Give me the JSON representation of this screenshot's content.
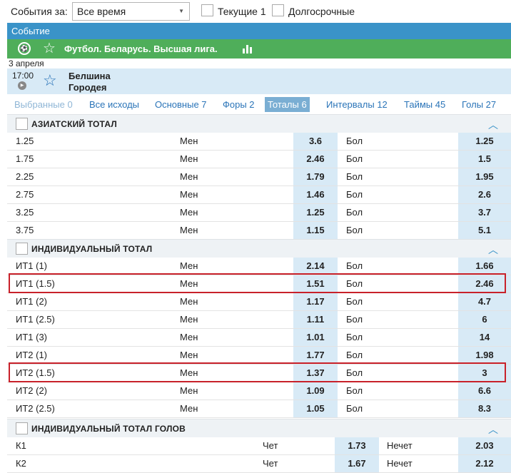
{
  "filter": {
    "label": "События за:",
    "period": "Все время",
    "current_label": "Текущие 1",
    "longterm_label": "Долгосрочные"
  },
  "event_header": "Событие",
  "league": {
    "title": "Футбол. Беларусь. Высшая лига."
  },
  "match": {
    "date": "3 апреля",
    "time": "17:00",
    "team1": "Белшина",
    "team2": "Городея"
  },
  "tabs": [
    {
      "label": "Выбранные 0",
      "state": "disabled"
    },
    {
      "label": "Все исходы",
      "state": "normal"
    },
    {
      "label": "Основные 7",
      "state": "normal"
    },
    {
      "label": "Форы 2",
      "state": "normal"
    },
    {
      "label": "Тоталы 6",
      "state": "active"
    },
    {
      "label": "Интервалы 12",
      "state": "normal"
    },
    {
      "label": "Таймы 45",
      "state": "normal"
    },
    {
      "label": "Голы 27",
      "state": "normal"
    }
  ],
  "sections": [
    {
      "title": "АЗИАТСКИЙ ТОТАЛ",
      "rows": [
        {
          "name": "1.25",
          "under_label": "Мен",
          "under": "3.6",
          "over_label": "Бол",
          "over": "1.25"
        },
        {
          "name": "1.75",
          "under_label": "Мен",
          "under": "2.46",
          "over_label": "Бол",
          "over": "1.5"
        },
        {
          "name": "2.25",
          "under_label": "Мен",
          "under": "1.79",
          "over_label": "Бол",
          "over": "1.95"
        },
        {
          "name": "2.75",
          "under_label": "Мен",
          "under": "1.46",
          "over_label": "Бол",
          "over": "2.6"
        },
        {
          "name": "3.25",
          "under_label": "Мен",
          "under": "1.25",
          "over_label": "Бол",
          "over": "3.7"
        },
        {
          "name": "3.75",
          "under_label": "Мен",
          "under": "1.15",
          "over_label": "Бол",
          "over": "5.1"
        }
      ]
    },
    {
      "title": "ИНДИВИДУАЛЬНЫЙ ТОТАЛ",
      "rows": [
        {
          "name": "ИТ1 (1)",
          "under_label": "Мен",
          "under": "2.14",
          "over_label": "Бол",
          "over": "1.66"
        },
        {
          "name": "ИТ1 (1.5)",
          "under_label": "Мен",
          "under": "1.51",
          "over_label": "Бол",
          "over": "2.46",
          "highlighted": true
        },
        {
          "name": "ИТ1 (2)",
          "under_label": "Мен",
          "under": "1.17",
          "over_label": "Бол",
          "over": "4.7"
        },
        {
          "name": "ИТ1 (2.5)",
          "under_label": "Мен",
          "under": "1.11",
          "over_label": "Бол",
          "over": "6"
        },
        {
          "name": "ИТ1 (3)",
          "under_label": "Мен",
          "under": "1.01",
          "over_label": "Бол",
          "over": "14"
        },
        {
          "name": "ИТ2 (1)",
          "under_label": "Мен",
          "under": "1.77",
          "over_label": "Бол",
          "over": "1.98"
        },
        {
          "name": "ИТ2 (1.5)",
          "under_label": "Мен",
          "under": "1.37",
          "over_label": "Бол",
          "over": "3",
          "highlighted": true
        },
        {
          "name": "ИТ2 (2)",
          "under_label": "Мен",
          "under": "1.09",
          "over_label": "Бол",
          "over": "6.6"
        },
        {
          "name": "ИТ2 (2.5)",
          "under_label": "Мен",
          "under": "1.05",
          "over_label": "Бол",
          "over": "8.3"
        }
      ]
    },
    {
      "title": "ИНДИВИДУАЛЬНЫЙ ТОТАЛ ГОЛОВ",
      "layout": "even-odd",
      "rows": [
        {
          "name": "К1",
          "under_label": "Чет",
          "under": "1.73",
          "over_label": "Нечет",
          "over": "2.03"
        },
        {
          "name": "К2",
          "under_label": "Чет",
          "under": "1.67",
          "over_label": "Нечет",
          "over": "2.12"
        }
      ]
    }
  ],
  "colors": {
    "header_blue": "#3a93c8",
    "league_green": "#4fae5a",
    "odd_cell": "#d8eaf6",
    "highlight_red": "#c8212a"
  }
}
